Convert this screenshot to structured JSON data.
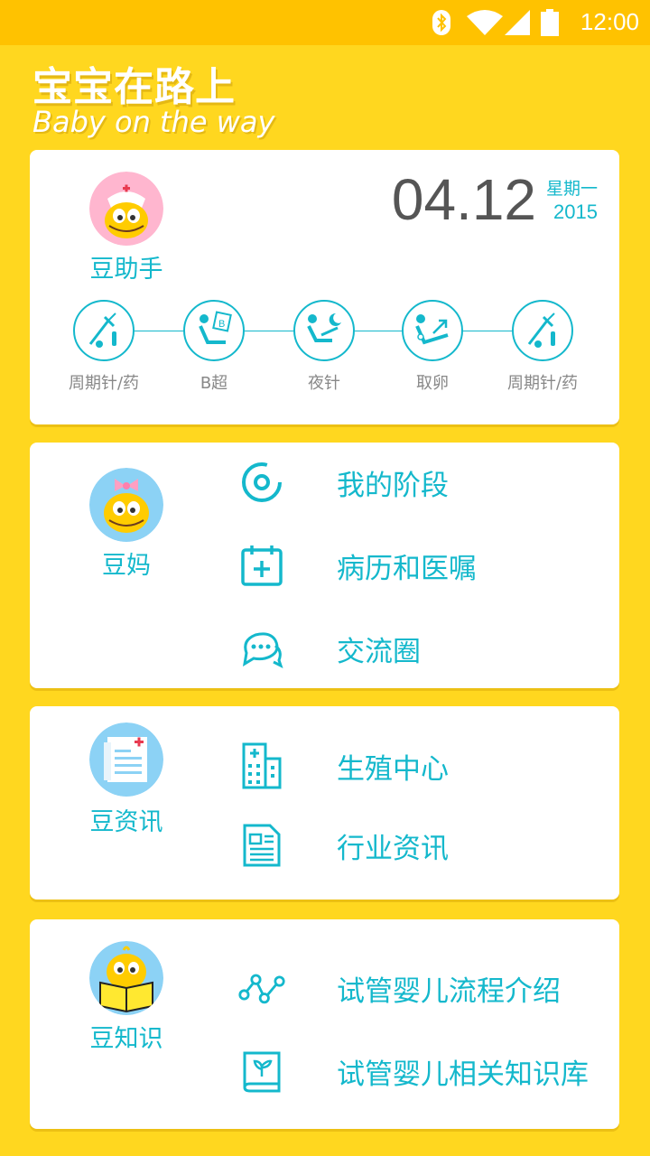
{
  "status_bar": {
    "time": "12:00"
  },
  "header": {
    "title": "宝宝在路上",
    "subtitle": "Baby on the way"
  },
  "assistant_card": {
    "label": "豆助手",
    "date": "04.12",
    "weekday": "星期一",
    "year": "2015",
    "steps": [
      {
        "label": "周期针/药",
        "icon": "syringe-pill-icon"
      },
      {
        "label": "B超",
        "icon": "ultrasound-icon"
      },
      {
        "label": "夜针",
        "icon": "night-injection-icon"
      },
      {
        "label": "取卵",
        "icon": "egg-retrieval-icon"
      },
      {
        "label": "周期针/药",
        "icon": "syringe-pill-icon"
      }
    ]
  },
  "mom_card": {
    "label": "豆妈",
    "items": [
      {
        "label": "我的阶段",
        "icon": "stage-target-icon"
      },
      {
        "label": "病历和医嘱",
        "icon": "calendar-plus-icon"
      },
      {
        "label": "交流圈",
        "icon": "chat-bubbles-icon"
      }
    ]
  },
  "news_card": {
    "label": "豆资讯",
    "items": [
      {
        "label": "生殖中心",
        "icon": "hospital-building-icon"
      },
      {
        "label": "行业资讯",
        "icon": "news-document-icon"
      }
    ]
  },
  "knowledge_card": {
    "label": "豆知识",
    "items": [
      {
        "label": "试管婴儿流程介绍",
        "icon": "process-nodes-icon"
      },
      {
        "label": "试管婴儿相关知识库",
        "icon": "knowledge-book-icon"
      }
    ]
  },
  "colors": {
    "background": "#FFD71F",
    "accent": "#14B8CC",
    "status_bar": "#FFC200"
  }
}
